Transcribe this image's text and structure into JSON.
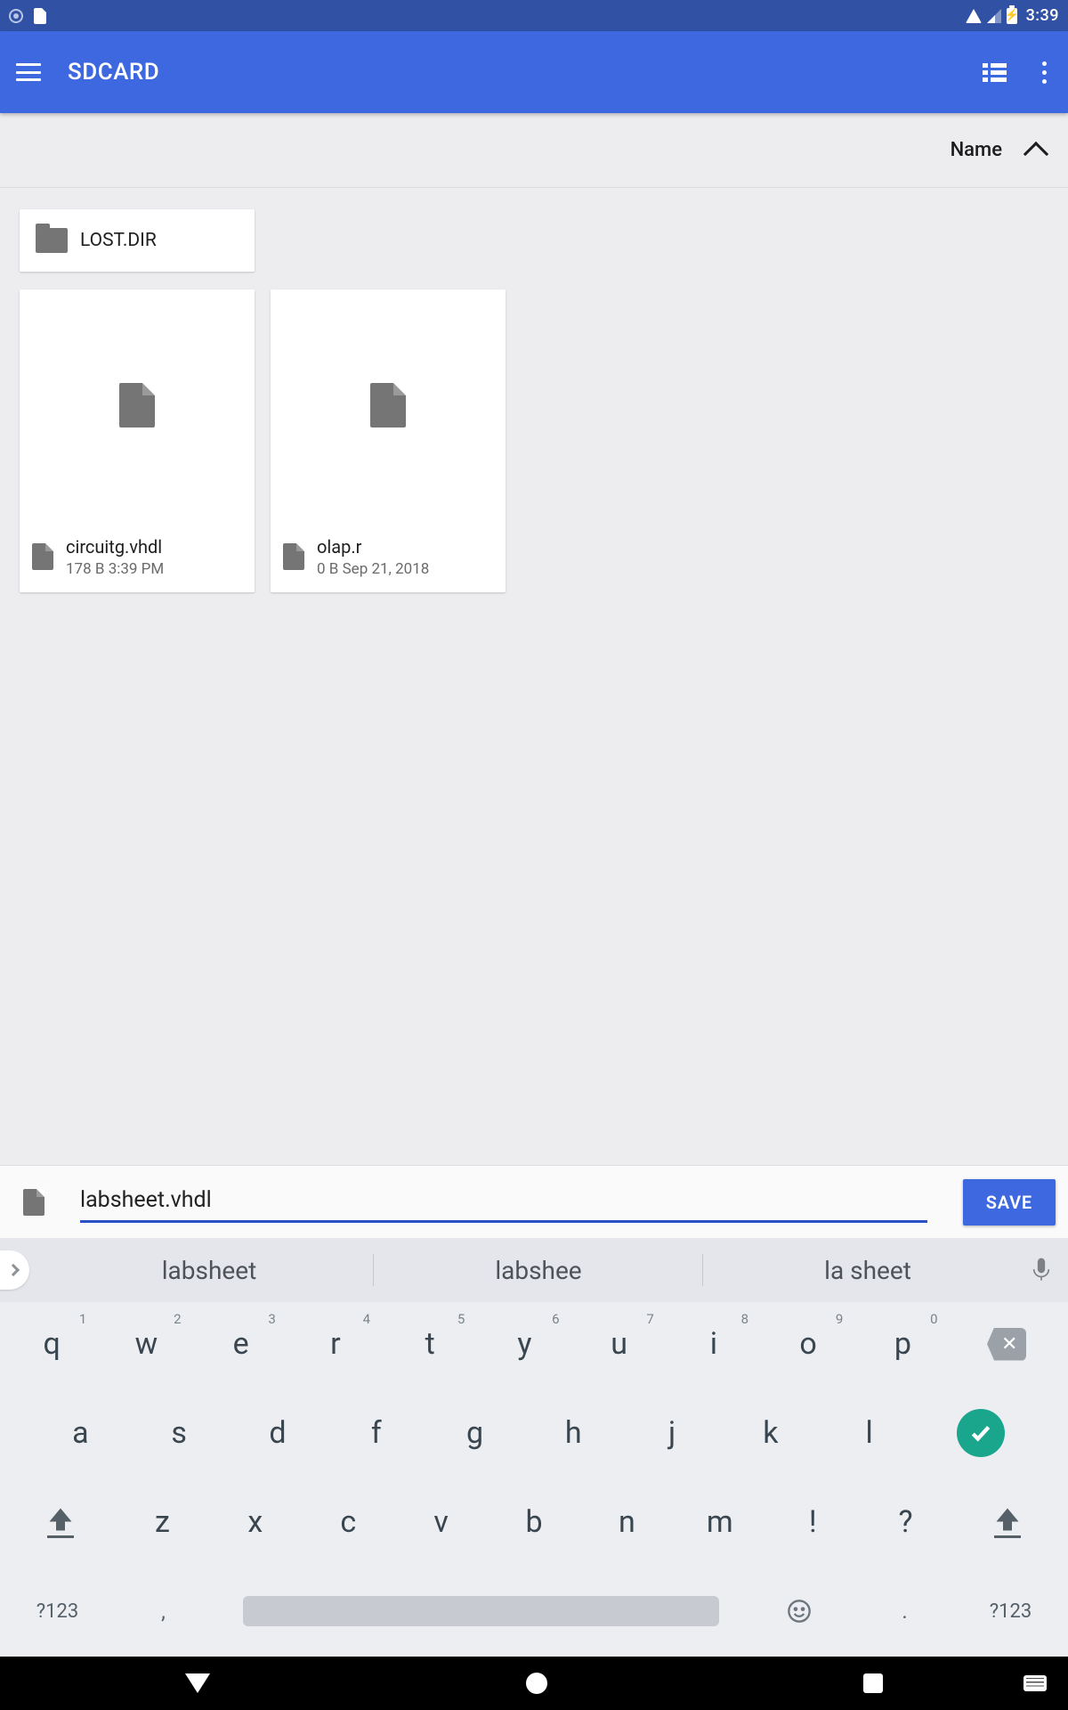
{
  "status": {
    "time": "3:39"
  },
  "appbar": {
    "title": "SDCARD"
  },
  "sort": {
    "label": "Name"
  },
  "folders": [
    {
      "name": "LOST.DIR"
    }
  ],
  "files": [
    {
      "name": "circuitg.vhdl",
      "meta": "178 B  3:39 PM"
    },
    {
      "name": "olap.r",
      "meta": "0 B  Sep 21, 2018"
    }
  ],
  "input": {
    "value": "labsheet.vhdl",
    "save": "SAVE"
  },
  "suggestions": [
    "labsheet",
    "labshee",
    "la sheet"
  ],
  "keyboard": {
    "row1": [
      {
        "k": "q",
        "h": "1"
      },
      {
        "k": "w",
        "h": "2"
      },
      {
        "k": "e",
        "h": "3"
      },
      {
        "k": "r",
        "h": "4"
      },
      {
        "k": "t",
        "h": "5"
      },
      {
        "k": "y",
        "h": "6"
      },
      {
        "k": "u",
        "h": "7"
      },
      {
        "k": "i",
        "h": "8"
      },
      {
        "k": "o",
        "h": "9"
      },
      {
        "k": "p",
        "h": "0"
      }
    ],
    "row2": [
      "a",
      "s",
      "d",
      "f",
      "g",
      "h",
      "j",
      "k",
      "l"
    ],
    "row3": [
      "z",
      "x",
      "c",
      "v",
      "b",
      "n",
      "m",
      "!",
      "?"
    ],
    "sym": "?123",
    "comma": ",",
    "period": "."
  }
}
